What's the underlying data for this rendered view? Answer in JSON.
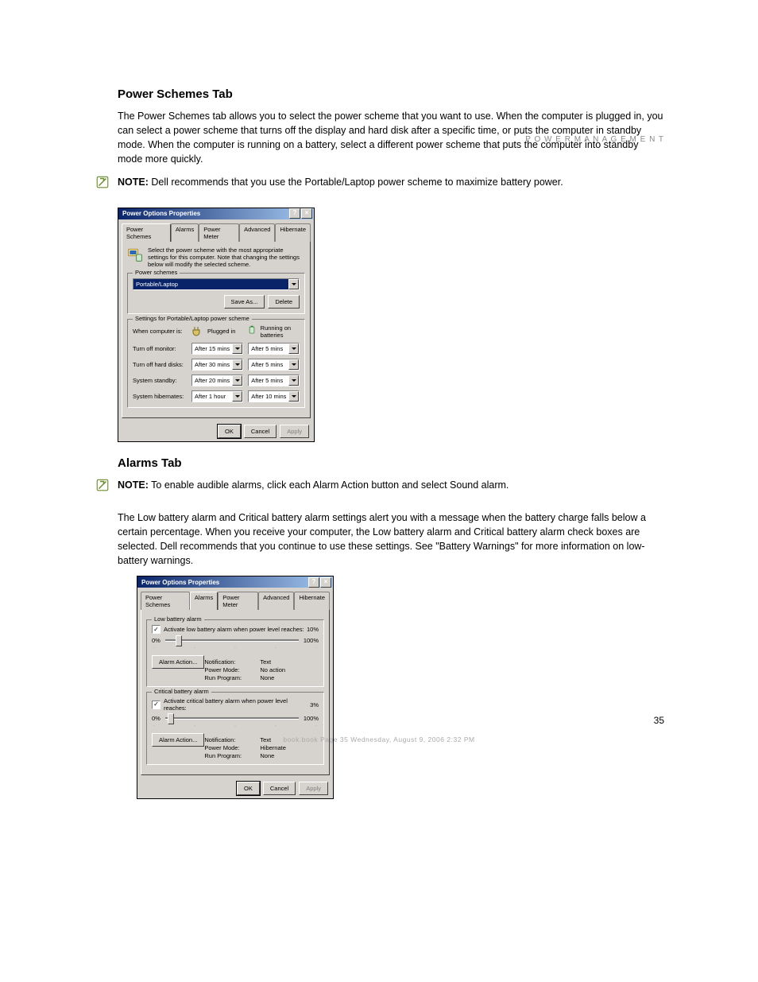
{
  "page": {
    "running_head": "P O W E R   M A N A G E M E N T",
    "number": "35",
    "book_title": "book.book  Page 35  Wednesday, August 9, 2006  2:32 PM"
  },
  "section1": {
    "heading": "Power Schemes Tab",
    "para": "The Power Schemes tab allows you to select the power scheme that you want to use. When the computer is plugged in, you can select a power scheme that turns off the display and hard disk after a specific time, or puts the computer in standby mode. When the computer is running on a battery, select a different power scheme that puts the computer into standby mode more quickly.",
    "note": "NOTE: Dell recommends that you use the Portable/Laptop power scheme to maximize battery power."
  },
  "section2": {
    "heading": "Alarms Tab",
    "note": "NOTE: To enable audible alarms, click each Alarm Action button and select Sound alarm.",
    "para": "The Low battery alarm and Critical battery alarm settings alert you with a message when the battery charge falls below a certain percentage. When you receive your computer, the Low battery alarm and Critical battery alarm check boxes are selected. Dell recommends that you continue to use these settings. See \"Battery Warnings\" for more information on low-battery warnings."
  },
  "dlg1": {
    "title": "Power Options Properties",
    "tabs": [
      "Power Schemes",
      "Alarms",
      "Power Meter",
      "Advanced",
      "Hibernate"
    ],
    "info_text": "Select the power scheme with the most appropriate settings for this computer. Note that changing the settings below will modify the selected scheme.",
    "group_schemes": "Power schemes",
    "scheme_value": "Portable/Laptop",
    "save_as": "Save As...",
    "delete": "Delete",
    "group_settings": "Settings for Portable/Laptop power scheme",
    "row_header_label": "When computer is:",
    "col_plugged": "Plugged in",
    "col_battery": "Running on batteries",
    "rows": {
      "monitor": {
        "label": "Turn off monitor:",
        "plugged": "After 15 mins",
        "battery": "After 5 mins"
      },
      "hdd": {
        "label": "Turn off hard disks:",
        "plugged": "After 30 mins",
        "battery": "After 5 mins"
      },
      "standby": {
        "label": "System standby:",
        "plugged": "After 20 mins",
        "battery": "After 5 mins"
      },
      "hibernate": {
        "label": "System hibernates:",
        "plugged": "After 1 hour",
        "battery": "After 10 mins"
      }
    },
    "ok": "OK",
    "cancel": "Cancel",
    "apply": "Apply"
  },
  "dlg2": {
    "title": "Power Options Properties",
    "tabs": [
      "Power Schemes",
      "Alarms",
      "Power Meter",
      "Advanced",
      "Hibernate"
    ],
    "low": {
      "group": "Low battery alarm",
      "check": "Activate low battery alarm when power level reaches:",
      "percent": "10%",
      "min": "0%",
      "max": "100%",
      "action": "Alarm Action...",
      "k_notify": "Notification:",
      "v_notify": "Text",
      "k_power": "Power Mode:",
      "v_power": "No action",
      "k_run": "Run Program:",
      "v_run": "None"
    },
    "crit": {
      "group": "Critical battery alarm",
      "check": "Activate critical battery alarm when power level reaches:",
      "percent": "3%",
      "min": "0%",
      "max": "100%",
      "action": "Alarm Action...",
      "k_notify": "Notification:",
      "v_notify": "Text",
      "k_power": "Power Mode:",
      "v_power": "Hibernate",
      "k_run": "Run Program:",
      "v_run": "None"
    },
    "ok": "OK",
    "cancel": "Cancel",
    "apply": "Apply"
  }
}
